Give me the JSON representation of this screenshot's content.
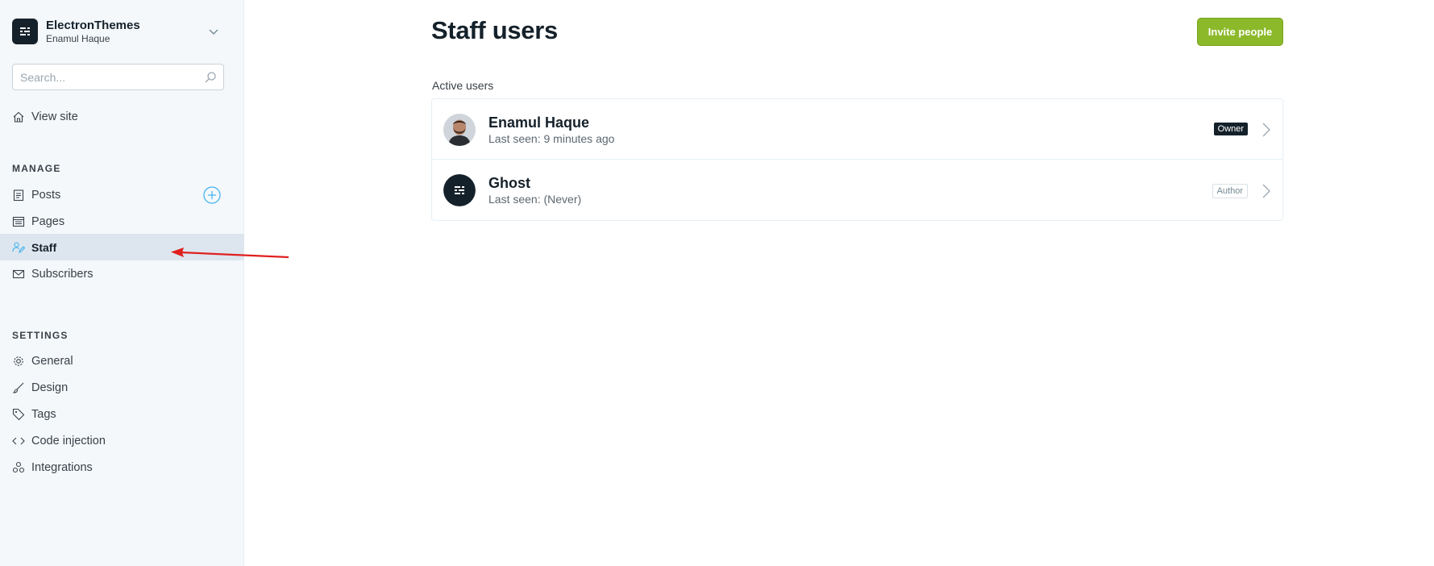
{
  "sidebar": {
    "site_title": "ElectronThemes",
    "site_user": "Enamul Haque",
    "search_placeholder": "Search...",
    "view_site": "View site",
    "manage_label": "MANAGE",
    "settings_label": "SETTINGS",
    "manage_items": [
      {
        "label": "Posts",
        "icon": "posts-icon"
      },
      {
        "label": "Pages",
        "icon": "pages-icon"
      },
      {
        "label": "Staff",
        "icon": "staff-icon",
        "active": true
      },
      {
        "label": "Subscribers",
        "icon": "mail-icon"
      }
    ],
    "settings_items": [
      {
        "label": "General",
        "icon": "gear-icon"
      },
      {
        "label": "Design",
        "icon": "brush-icon"
      },
      {
        "label": "Tags",
        "icon": "tag-icon"
      },
      {
        "label": "Code injection",
        "icon": "code-icon"
      },
      {
        "label": "Integrations",
        "icon": "integrations-icon"
      }
    ]
  },
  "main": {
    "title": "Staff users",
    "invite_button": "Invite people",
    "active_users_label": "Active users",
    "users": [
      {
        "name": "Enamul Haque",
        "last_seen": "Last seen: 9 minutes ago",
        "role": "Owner"
      },
      {
        "name": "Ghost",
        "last_seen": "Last seen: (Never)",
        "role": "Author"
      }
    ]
  },
  "colors": {
    "accent_green": "#8cb92a",
    "sidebar_bg": "#f4f8fb",
    "active_bg": "#dde6ee",
    "annotation_arrow": "#e02020",
    "add_icon_blue": "#3eb0ef"
  }
}
